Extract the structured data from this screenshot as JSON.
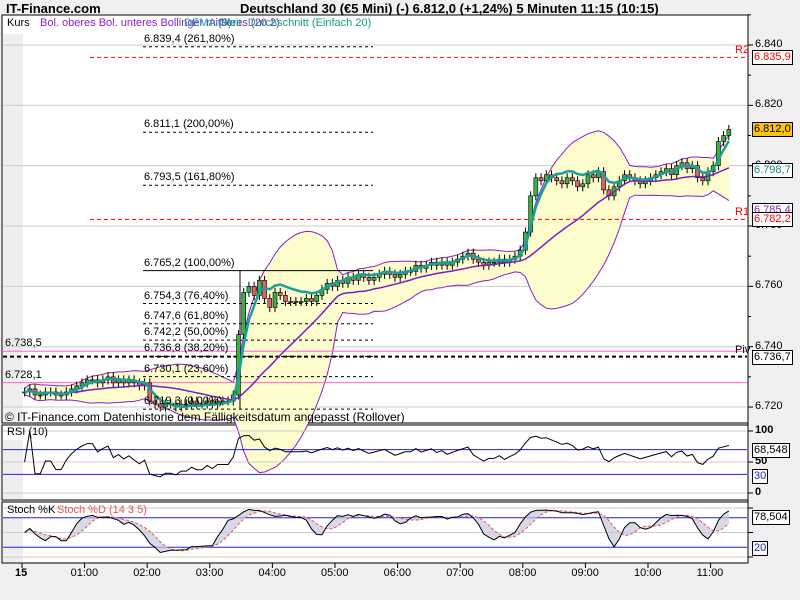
{
  "header": {
    "site": "IT-Finance.com",
    "title": "Deutschland 30 (€5 Mini) (-)   6.812,0 (+1,24%)   5 Minuten  11:15 (10:15)"
  },
  "legend": {
    "kurs": "Kurs",
    "boll": "Bol. oberes Bol. unteres Bollinger mittleres (20 2)",
    "dema": "DEMA (9)",
    "sma": "Gleit. Durchschnitt (Einfach 20)"
  },
  "footer_note": "© IT-Finance.com  Datenhistorie dem Fälligkeitsdatum angepasst (Rollover)",
  "colors": {
    "up": "#3cb043",
    "down": "#d9646a",
    "boll": "#8a1fc9",
    "dema": "#1a9e9e",
    "sma": "#7a1fc0",
    "bandfill": "#fdfccc",
    "pivot": "#ff0000",
    "pink": "#ff66cc",
    "grid": "#cccccc",
    "blue": "#2020dd"
  },
  "chart_data": [
    {
      "type": "candlestick",
      "title": "Deutschland 30 (€5 Mini)",
      "interval": "5 Minuten",
      "ylim": [
        6715,
        6845
      ],
      "yticks": [
        "6.720",
        "6.740",
        "6.760",
        "6.780",
        "6.800",
        "6.820",
        "6.840"
      ],
      "ytick_values": [
        6720,
        6740,
        6760,
        6780,
        6800,
        6820,
        6840
      ],
      "xticks": [
        "15",
        "01:00",
        "02:00",
        "03:00",
        "04:00",
        "05:00",
        "06:00",
        "07:00",
        "08:00",
        "09:00",
        "10:00",
        "11:00"
      ],
      "start": "00:00",
      "closes": [
        6725,
        6726,
        6724,
        6724,
        6725,
        6725,
        6724,
        6724,
        6725,
        6726,
        6727,
        6728,
        6729,
        6729,
        6728,
        6729,
        6730,
        6728,
        6729,
        6728,
        6729,
        6728,
        6727,
        6728,
        6722,
        6721,
        6720,
        6721,
        6721,
        6720,
        6721,
        6721,
        6722,
        6721,
        6721,
        6722,
        6721,
        6722,
        6722,
        6722,
        6724,
        6744,
        6758,
        6760,
        6757,
        6762,
        6756,
        6753,
        6758,
        6757,
        6755,
        6755,
        6755,
        6755,
        6756,
        6755,
        6757,
        6759,
        6761,
        6760,
        6762,
        6761,
        6763,
        6762,
        6764,
        6763,
        6762,
        6763,
        6764,
        6765,
        6764,
        6763,
        6764,
        6765,
        6765,
        6767,
        6766,
        6767,
        6768,
        6767,
        6768,
        6767,
        6768,
        6769,
        6770,
        6771,
        6769,
        6768,
        6767,
        6768,
        6768,
        6769,
        6768,
        6769,
        6770,
        6772,
        6778,
        6790,
        6796,
        6795,
        6797,
        6796,
        6795,
        6794,
        6796,
        6795,
        6793,
        6794,
        6797,
        6796,
        6798,
        6792,
        6790,
        6793,
        6795,
        6797,
        6796,
        6795,
        6794,
        6795,
        6796,
        6797,
        6798,
        6799,
        6797,
        6800,
        6801,
        6799,
        6800,
        6796,
        6795,
        6798,
        6800,
        6808,
        6810,
        6812
      ],
      "fib": [
        {
          "value": 6839.4,
          "label": "6.839,4 (261,80%)"
        },
        {
          "value": 6811.1,
          "label": "6.811,1 (200,00%)"
        },
        {
          "value": 6793.5,
          "label": "6.793,5 (161,80%)"
        },
        {
          "value": 6765.2,
          "label": "6.765,2 (100,00%)"
        },
        {
          "value": 6754.3,
          "label": "6.754,3 (76,40%)"
        },
        {
          "value": 6747.6,
          "label": "6.747,6 (61,80%)"
        },
        {
          "value": 6742.2,
          "label": "6.742,2 (50,00%)"
        },
        {
          "value": 6736.8,
          "label": "6.736,8 (38,20%)"
        },
        {
          "value": 6730.1,
          "label": "6.730,1 (23,60%)"
        },
        {
          "value": 6719.3,
          "label": "6.719,3 (0,00%)"
        }
      ],
      "pivots": [
        {
          "name": "R2",
          "value": 6835.9
        },
        {
          "name": "R1",
          "value": 6782.2
        },
        {
          "name": "Piv",
          "value": 6736.7
        }
      ],
      "pink_levels": [
        {
          "value": 6738.5,
          "label": "6.738,5"
        },
        {
          "value": 6728.1,
          "label": "6.728,1"
        }
      ],
      "value_boxes": [
        {
          "label": "6.835,9",
          "value": 6835.9,
          "color": "#ff0000"
        },
        {
          "label": "6.812,0",
          "value": 6812.0,
          "color": "#000000",
          "bg": "#ffc20e"
        },
        {
          "label": "6.798,7",
          "value": 6798.7,
          "color": "#1a8a5a"
        },
        {
          "label": "6.785,4",
          "value": 6785.4,
          "color": "#8a1fc9"
        },
        {
          "label": "6.782,2",
          "value": 6782.2,
          "color": "#ff0000"
        },
        {
          "label": "6.736,7",
          "value": 6736.7,
          "color": "#000000"
        }
      ]
    },
    {
      "type": "line",
      "title": "RSI (10)",
      "ylim": [
        0,
        100
      ],
      "yticks": [
        "0",
        "50",
        "100"
      ],
      "levels": [
        30,
        70
      ],
      "last_label": "68,548",
      "level_label": "30"
    },
    {
      "type": "line",
      "title": "Stoch %K",
      "title2": "Stoch %D (14 3 5)",
      "ylim": [
        0,
        100
      ],
      "yticks": [
        "0",
        "50",
        "100"
      ],
      "levels": [
        20,
        80
      ],
      "last_label": "78,504",
      "level_label": "20"
    }
  ]
}
